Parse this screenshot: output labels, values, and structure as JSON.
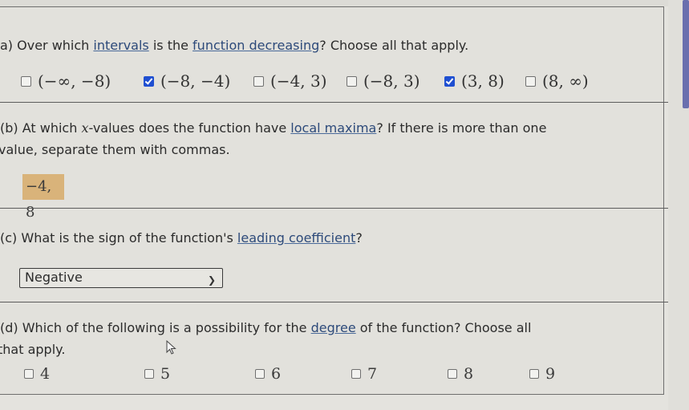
{
  "part_a": {
    "question_prefix": "a) Over which ",
    "term_intervals": "intervals",
    "question_mid": " is the ",
    "term_function_decreasing": "function decreasing",
    "question_suffix": "? Choose all that apply.",
    "options": [
      {
        "label": "(−∞, −8)",
        "checked": false
      },
      {
        "label": "(−8, −4)",
        "checked": true
      },
      {
        "label": "(−4, 3)",
        "checked": false
      },
      {
        "label": "(−8, 3)",
        "checked": false
      },
      {
        "label": "(3, 8)",
        "checked": true
      },
      {
        "label": "(8, ∞)",
        "checked": false
      }
    ]
  },
  "part_b": {
    "line1_prefix": "(b) At which ",
    "var_x": "x",
    "line1_mid": "-values does the function have ",
    "term_local_maxima": "local maxima",
    "line1_suffix": "? If there is more than one",
    "line2": "value, separate them with commas.",
    "answer_value": "−4, 8"
  },
  "part_c": {
    "question_prefix": "(c) What is the sign of the function's ",
    "term_leading_coefficient": "leading coefficient",
    "question_suffix": "?",
    "selected_value": "Negative"
  },
  "part_d": {
    "line1_prefix": "(d) Which of the following is a possibility for the ",
    "term_degree": "degree",
    "line1_suffix": " of the function? Choose all",
    "line2": "that apply.",
    "options": [
      {
        "label": "4",
        "checked": false
      },
      {
        "label": "5",
        "checked": false
      },
      {
        "label": "6",
        "checked": false
      },
      {
        "label": "7",
        "checked": false
      },
      {
        "label": "8",
        "checked": false
      },
      {
        "label": "9",
        "checked": false
      }
    ]
  },
  "colors": {
    "checkbox_checked": "#1f4fd1",
    "term_link": "#2d4a7a",
    "answer_highlight": "#d9b37a",
    "scrollbar_thumb": "#6a6fae"
  }
}
